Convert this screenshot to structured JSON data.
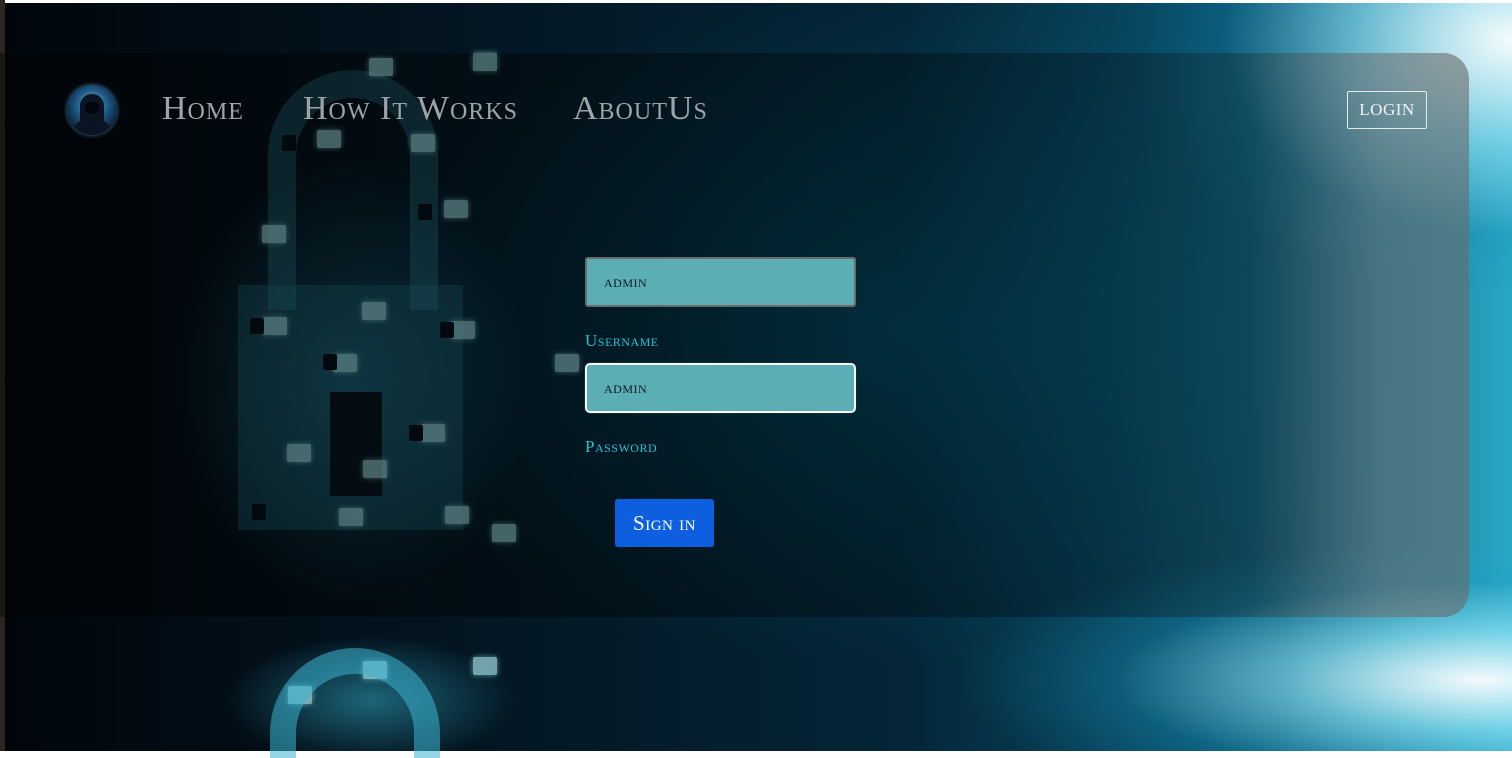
{
  "nav": {
    "items": [
      {
        "label": "Home"
      },
      {
        "label": "How It Works"
      },
      {
        "label": "AboutUs"
      }
    ],
    "login_label": "LOGIN",
    "avatar_icon": "hooded-hacker-icon"
  },
  "form": {
    "username_value": "admin",
    "username_label": "Username",
    "password_value": "admin",
    "password_label": "Password",
    "submit_label": "Sign in"
  },
  "background": {
    "image": "pixelated-padlock-cyber-background",
    "accent": "#21c3d6",
    "field_color": "#5baeb4",
    "button_color": "#0d5fe0"
  }
}
